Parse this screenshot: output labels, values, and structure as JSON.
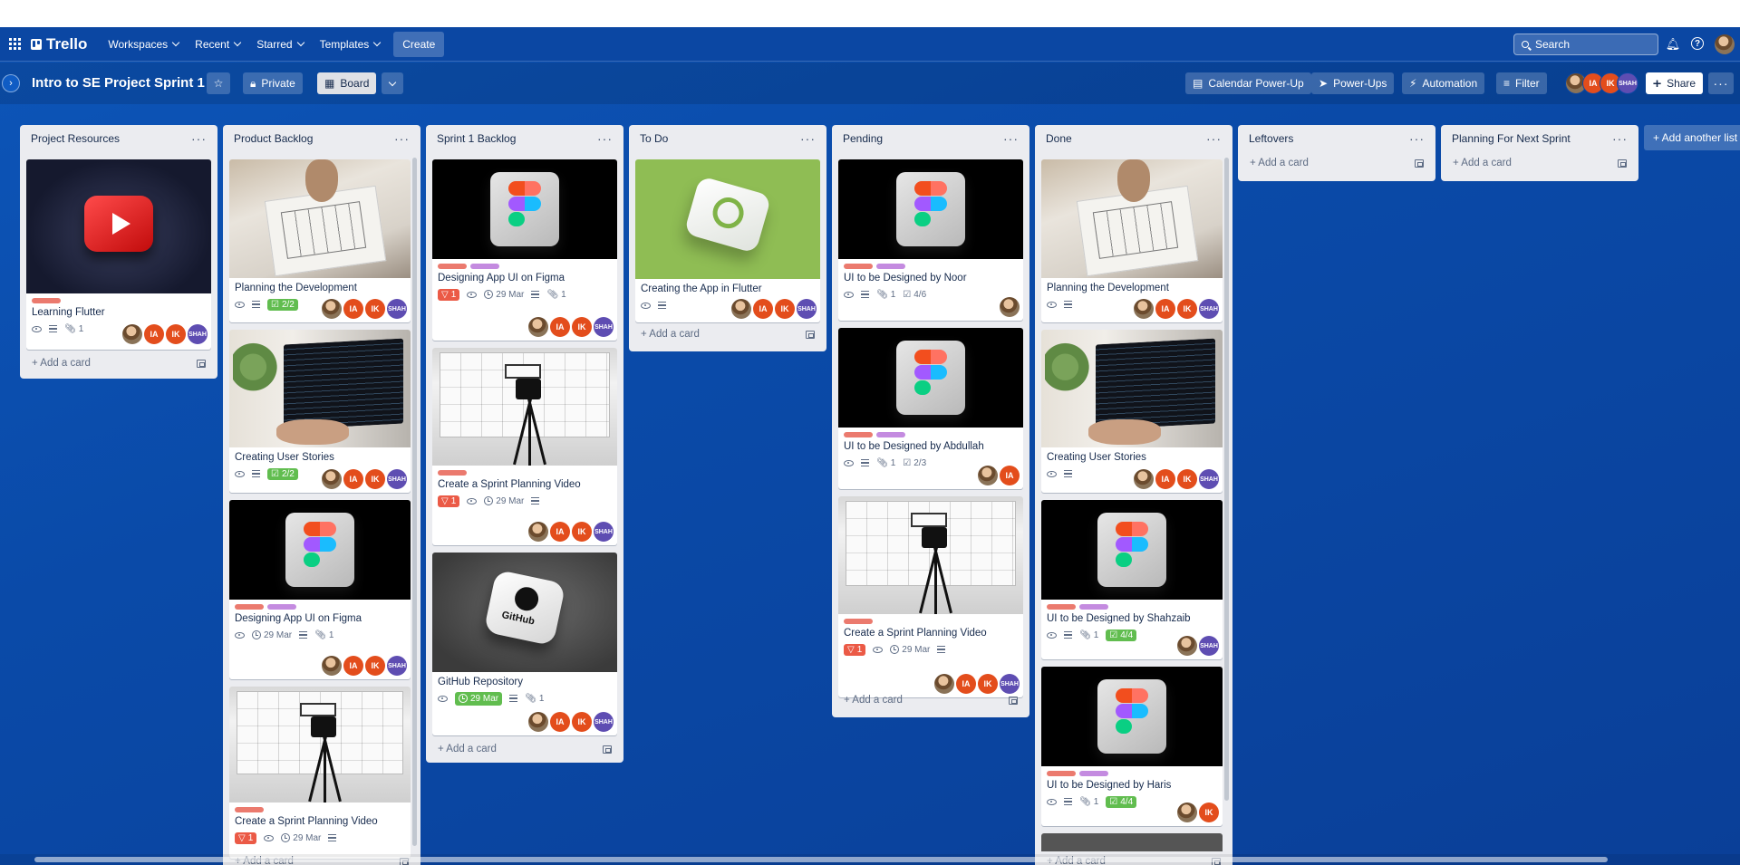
{
  "nav": {
    "logo": "Trello",
    "menus": [
      "Workspaces",
      "Recent",
      "Starred",
      "Templates"
    ],
    "create": "Create",
    "search_placeholder": "Search"
  },
  "board": {
    "title": "Intro to SE Project Sprint 1",
    "visibility": "Private",
    "view": "Board",
    "powerups": [
      "Calendar Power-Up",
      "Power-Ups",
      "Automation"
    ],
    "filter": "Filter",
    "share": "Share",
    "add_list": "+ Add another list",
    "add_card": "+ Add a card"
  },
  "members": {
    "ia": "IA",
    "ik": "IK",
    "shah": "SHAH"
  },
  "colors": {
    "label_red": "#eb7a6e",
    "label_purple": "#c48be0",
    "board_bg": "#0b4aa6",
    "badge_green": "#61bd4f",
    "vote_red": "#eb5a46"
  },
  "lists": [
    {
      "title": "Project Resources",
      "cards": [
        {
          "title": "Learning Flutter",
          "cover": "youtube-3d-icon",
          "labels": [
            "red"
          ],
          "badges": {
            "watch": true,
            "desc": true,
            "attachments": "1"
          },
          "members": [
            "photo",
            "IA",
            "IK",
            "SHAH"
          ]
        }
      ]
    },
    {
      "title": "Product Backlog",
      "cards": [
        {
          "title": "Planning the Development",
          "cover": "sketch-drawing",
          "badges": {
            "watch": true,
            "desc": true,
            "checklist": "2/2"
          },
          "members": [
            "photo",
            "IA",
            "IK",
            "SHAH"
          ]
        },
        {
          "title": "Creating User Stories",
          "cover": "laptop-code",
          "badges": {
            "watch": true,
            "desc": true,
            "checklist": "2/2"
          },
          "members": [
            "photo",
            "IA",
            "IK",
            "SHAH"
          ]
        },
        {
          "title": "Designing App UI on Figma",
          "cover": "figma-3d-icon",
          "labels": [
            "red",
            "purple"
          ],
          "badges": {
            "watch": true,
            "due": "29 Mar",
            "desc": true,
            "attachments": "1"
          },
          "members": [
            "photo",
            "IA",
            "IK",
            "SHAH"
          ]
        },
        {
          "title": "Create a Sprint Planning Video",
          "cover": "tripod-camera",
          "labels": [
            "red"
          ],
          "badges": {
            "votes": "1",
            "watch": true,
            "due": "29 Mar",
            "desc": true
          }
        }
      ]
    },
    {
      "title": "Sprint 1 Backlog",
      "cards": [
        {
          "title": "Designing App UI on Figma",
          "cover": "figma-3d-icon",
          "labels": [
            "red",
            "purple"
          ],
          "badges": {
            "votes": "1",
            "watch": true,
            "due": "29 Mar",
            "desc": true,
            "attachments": "1"
          },
          "members": [
            "photo",
            "IA",
            "IK",
            "SHAH"
          ]
        },
        {
          "title": "Create a Sprint Planning Video",
          "cover": "tripod-camera",
          "labels": [
            "red"
          ],
          "badges": {
            "votes": "1",
            "watch": true,
            "due": "29 Mar",
            "desc": true
          },
          "members": [
            "photo",
            "IA",
            "IK",
            "SHAH"
          ]
        },
        {
          "title": "GitHub Repository",
          "cover": "github-3d-icon",
          "badges": {
            "watch": true,
            "due_complete": "29 Mar",
            "desc": true,
            "attachments": "1"
          },
          "members": [
            "photo",
            "IA",
            "IK",
            "SHAH"
          ]
        }
      ],
      "github_text": "GitHub"
    },
    {
      "title": "To Do",
      "cards": [
        {
          "title": "Creating the App in Flutter",
          "cover": "flutter-3d-icon",
          "badges": {
            "watch": true,
            "desc": true
          },
          "members": [
            "photo",
            "IA",
            "IK",
            "SHAH"
          ]
        }
      ]
    },
    {
      "title": "Pending",
      "cards": [
        {
          "title": "UI to be Designed by Noor",
          "cover": "figma-3d-icon",
          "labels": [
            "red",
            "purple"
          ],
          "badges": {
            "watch": true,
            "desc": true,
            "attachments": "1",
            "checklist": "4/6"
          },
          "members": [
            "photo"
          ]
        },
        {
          "title": "UI to be Designed by Abdullah",
          "cover": "figma-3d-icon",
          "labels": [
            "red",
            "purple"
          ],
          "badges": {
            "watch": true,
            "desc": true,
            "attachments": "1",
            "checklist": "2/3"
          },
          "members": [
            "photo",
            "IA"
          ]
        },
        {
          "title": "Create a Sprint Planning Video",
          "cover": "tripod-camera",
          "labels": [
            "red"
          ],
          "badges": {
            "votes": "1",
            "watch": true,
            "due": "29 Mar",
            "desc": true
          },
          "members": [
            "photo",
            "IA",
            "IK",
            "SHAH"
          ]
        }
      ]
    },
    {
      "title": "Done",
      "cards": [
        {
          "title": "Planning the Development",
          "cover": "sketch-drawing",
          "badges": {
            "watch": true,
            "desc": true
          },
          "members": [
            "photo",
            "IA",
            "IK",
            "SHAH"
          ]
        },
        {
          "title": "Creating User Stories",
          "cover": "laptop-code",
          "badges": {
            "watch": true,
            "desc": true
          },
          "members": [
            "photo",
            "IA",
            "IK",
            "SHAH"
          ]
        },
        {
          "title": "UI to be Designed by Shahzaib",
          "cover": "figma-3d-icon",
          "labels": [
            "red",
            "purple"
          ],
          "badges": {
            "watch": true,
            "desc": true,
            "attachments": "1",
            "checklist": "4/4"
          },
          "members": [
            "photo",
            "SHAH"
          ]
        },
        {
          "title": "UI to be Designed by Haris",
          "cover": "figma-3d-icon",
          "labels": [
            "red",
            "purple"
          ],
          "badges": {
            "watch": true,
            "desc": true,
            "attachments": "1",
            "checklist": "4/4"
          },
          "members": [
            "photo",
            "IK"
          ]
        }
      ]
    },
    {
      "title": "Leftovers",
      "cards": []
    },
    {
      "title": "Planning For Next Sprint",
      "cards": []
    }
  ]
}
